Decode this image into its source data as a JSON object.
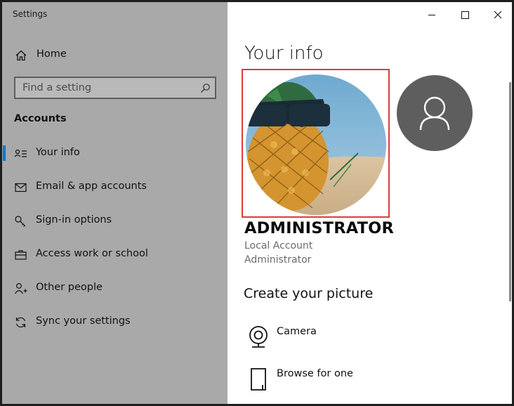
{
  "window": {
    "title": "Settings"
  },
  "sidebar": {
    "home_label": "Home",
    "search_placeholder": "Find a setting",
    "section_title": "Accounts",
    "items": [
      {
        "label": "Your info",
        "icon": "person-card-icon",
        "active": true
      },
      {
        "label": "Email & app accounts",
        "icon": "mail-icon",
        "active": false
      },
      {
        "label": "Sign-in options",
        "icon": "key-icon",
        "active": false
      },
      {
        "label": "Access work or school",
        "icon": "briefcase-icon",
        "active": false
      },
      {
        "label": "Other people",
        "icon": "person-add-icon",
        "active": false
      },
      {
        "label": "Sync your settings",
        "icon": "sync-icon",
        "active": false
      }
    ]
  },
  "content": {
    "page_title": "Your info",
    "user_name": "ADMINISTRATOR",
    "account_type": "Local Account",
    "account_role": "Administrator",
    "create_picture_title": "Create your picture",
    "actions": [
      {
        "label": "Camera",
        "icon": "camera-icon"
      },
      {
        "label": "Browse for one",
        "icon": "file-icon"
      }
    ]
  },
  "colors": {
    "sidebar_bg": "#a9a9a9",
    "accent": "#0078d7",
    "highlight_border": "#e03a3a",
    "avatar_bg": "#5e5e5e"
  }
}
